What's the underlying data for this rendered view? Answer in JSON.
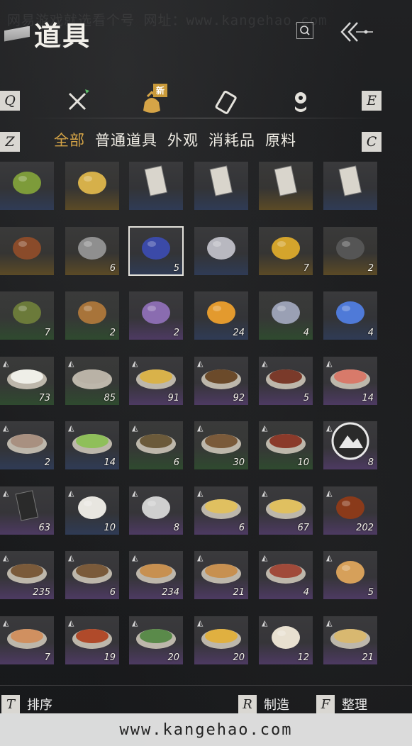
{
  "header": {
    "watermark_top": "网易游戏就选看个号  网址：www.kangehao.com",
    "title": "道具"
  },
  "tabs": {
    "left_key": "Q",
    "right_key": "E",
    "new_badge": "新",
    "icons": [
      "crossed-swords-icon",
      "pouch-icon",
      "scroll-icon",
      "jade-pendant-icon"
    ]
  },
  "categories": {
    "left_key": "Z",
    "right_key": "C",
    "items": [
      "全部",
      "普通道具",
      "外观",
      "消耗品",
      "原料"
    ],
    "active": 0
  },
  "items": [
    {
      "name": "green-fruit",
      "count": "",
      "bg": "blue"
    },
    {
      "name": "gold-bars",
      "count": "",
      "bg": "gold"
    },
    {
      "name": "paper-note",
      "count": "",
      "bg": "blue"
    },
    {
      "name": "paper-note",
      "count": "",
      "bg": "blue"
    },
    {
      "name": "paper-note",
      "count": "",
      "bg": "gold"
    },
    {
      "name": "paper-note",
      "count": "",
      "bg": "blue"
    },
    {
      "name": "lacquer-box",
      "count": "",
      "bg": "gold"
    },
    {
      "name": "rock",
      "count": "6",
      "bg": "gold"
    },
    {
      "name": "blue-flower",
      "count": "5",
      "bg": "blue"
    },
    {
      "name": "silver-twig",
      "count": "",
      "bg": "blue"
    },
    {
      "name": "golden-toad",
      "count": "7",
      "bg": "gold"
    },
    {
      "name": "dark-stone",
      "count": "2",
      "bg": "gold"
    },
    {
      "name": "cricket",
      "count": "7",
      "bg": "green"
    },
    {
      "name": "dragonfly",
      "count": "2",
      "bg": "green"
    },
    {
      "name": "moth",
      "count": "2",
      "bg": "purple"
    },
    {
      "name": "orb-stand",
      "count": "24",
      "bg": "blue"
    },
    {
      "name": "staff",
      "count": "4",
      "bg": "green"
    },
    {
      "name": "blue-charm",
      "count": "4",
      "bg": "blue"
    },
    {
      "name": "buns",
      "count": "73",
      "bg": "green"
    },
    {
      "name": "fish-soup",
      "count": "85",
      "bg": "green"
    },
    {
      "name": "egg-custard",
      "count": "91",
      "bg": "purple"
    },
    {
      "name": "braised-meat",
      "count": "92",
      "bg": "purple"
    },
    {
      "name": "beef-bowl",
      "count": "5",
      "bg": "purple"
    },
    {
      "name": "fried-egg-dish",
      "count": "14",
      "bg": "purple"
    },
    {
      "name": "fish-plate",
      "count": "2",
      "bg": "blue"
    },
    {
      "name": "okra-plate",
      "count": "14",
      "bg": "blue"
    },
    {
      "name": "stir-fry",
      "count": "6",
      "bg": "green"
    },
    {
      "name": "stew-pot",
      "count": "30",
      "bg": "green"
    },
    {
      "name": "spicy-bowl",
      "count": "10",
      "bg": "green"
    },
    {
      "name": "mountain-emblem",
      "count": "8",
      "bg": "purple"
    },
    {
      "name": "gold-talisman",
      "count": "63",
      "bg": "purple"
    },
    {
      "name": "white-vase",
      "count": "10",
      "bg": "blue"
    },
    {
      "name": "stone-mountain",
      "count": "8",
      "bg": "purple"
    },
    {
      "name": "noodle-plate",
      "count": "6",
      "bg": "purple"
    },
    {
      "name": "noodle-plate",
      "count": "67",
      "bg": "purple"
    },
    {
      "name": "wine-gourd",
      "count": "202",
      "bg": "purple"
    },
    {
      "name": "clay-pot",
      "count": "235",
      "bg": "purple"
    },
    {
      "name": "clay-pot",
      "count": "6",
      "bg": "purple"
    },
    {
      "name": "pastry-plate",
      "count": "234",
      "bg": "purple"
    },
    {
      "name": "pastry-plate",
      "count": "21",
      "bg": "purple"
    },
    {
      "name": "steak-plate",
      "count": "4",
      "bg": "purple"
    },
    {
      "name": "cake-slice",
      "count": "5",
      "bg": "purple"
    },
    {
      "name": "toast-plate",
      "count": "7",
      "bg": "purple"
    },
    {
      "name": "red-soup",
      "count": "19",
      "bg": "purple"
    },
    {
      "name": "greens-bowl",
      "count": "20",
      "bg": "purple"
    },
    {
      "name": "dumpling-soup",
      "count": "20",
      "bg": "purple"
    },
    {
      "name": "steamed-bun",
      "count": "12",
      "bg": "purple"
    },
    {
      "name": "noodle-bowl",
      "count": "21",
      "bg": "purple"
    }
  ],
  "footer": {
    "sort_key": "T",
    "sort_label": "排序",
    "craft_key": "R",
    "craft_label": "制造",
    "arrange_key": "F",
    "arrange_label": "整理"
  },
  "watermark_bottom": "www.kangehao.com"
}
